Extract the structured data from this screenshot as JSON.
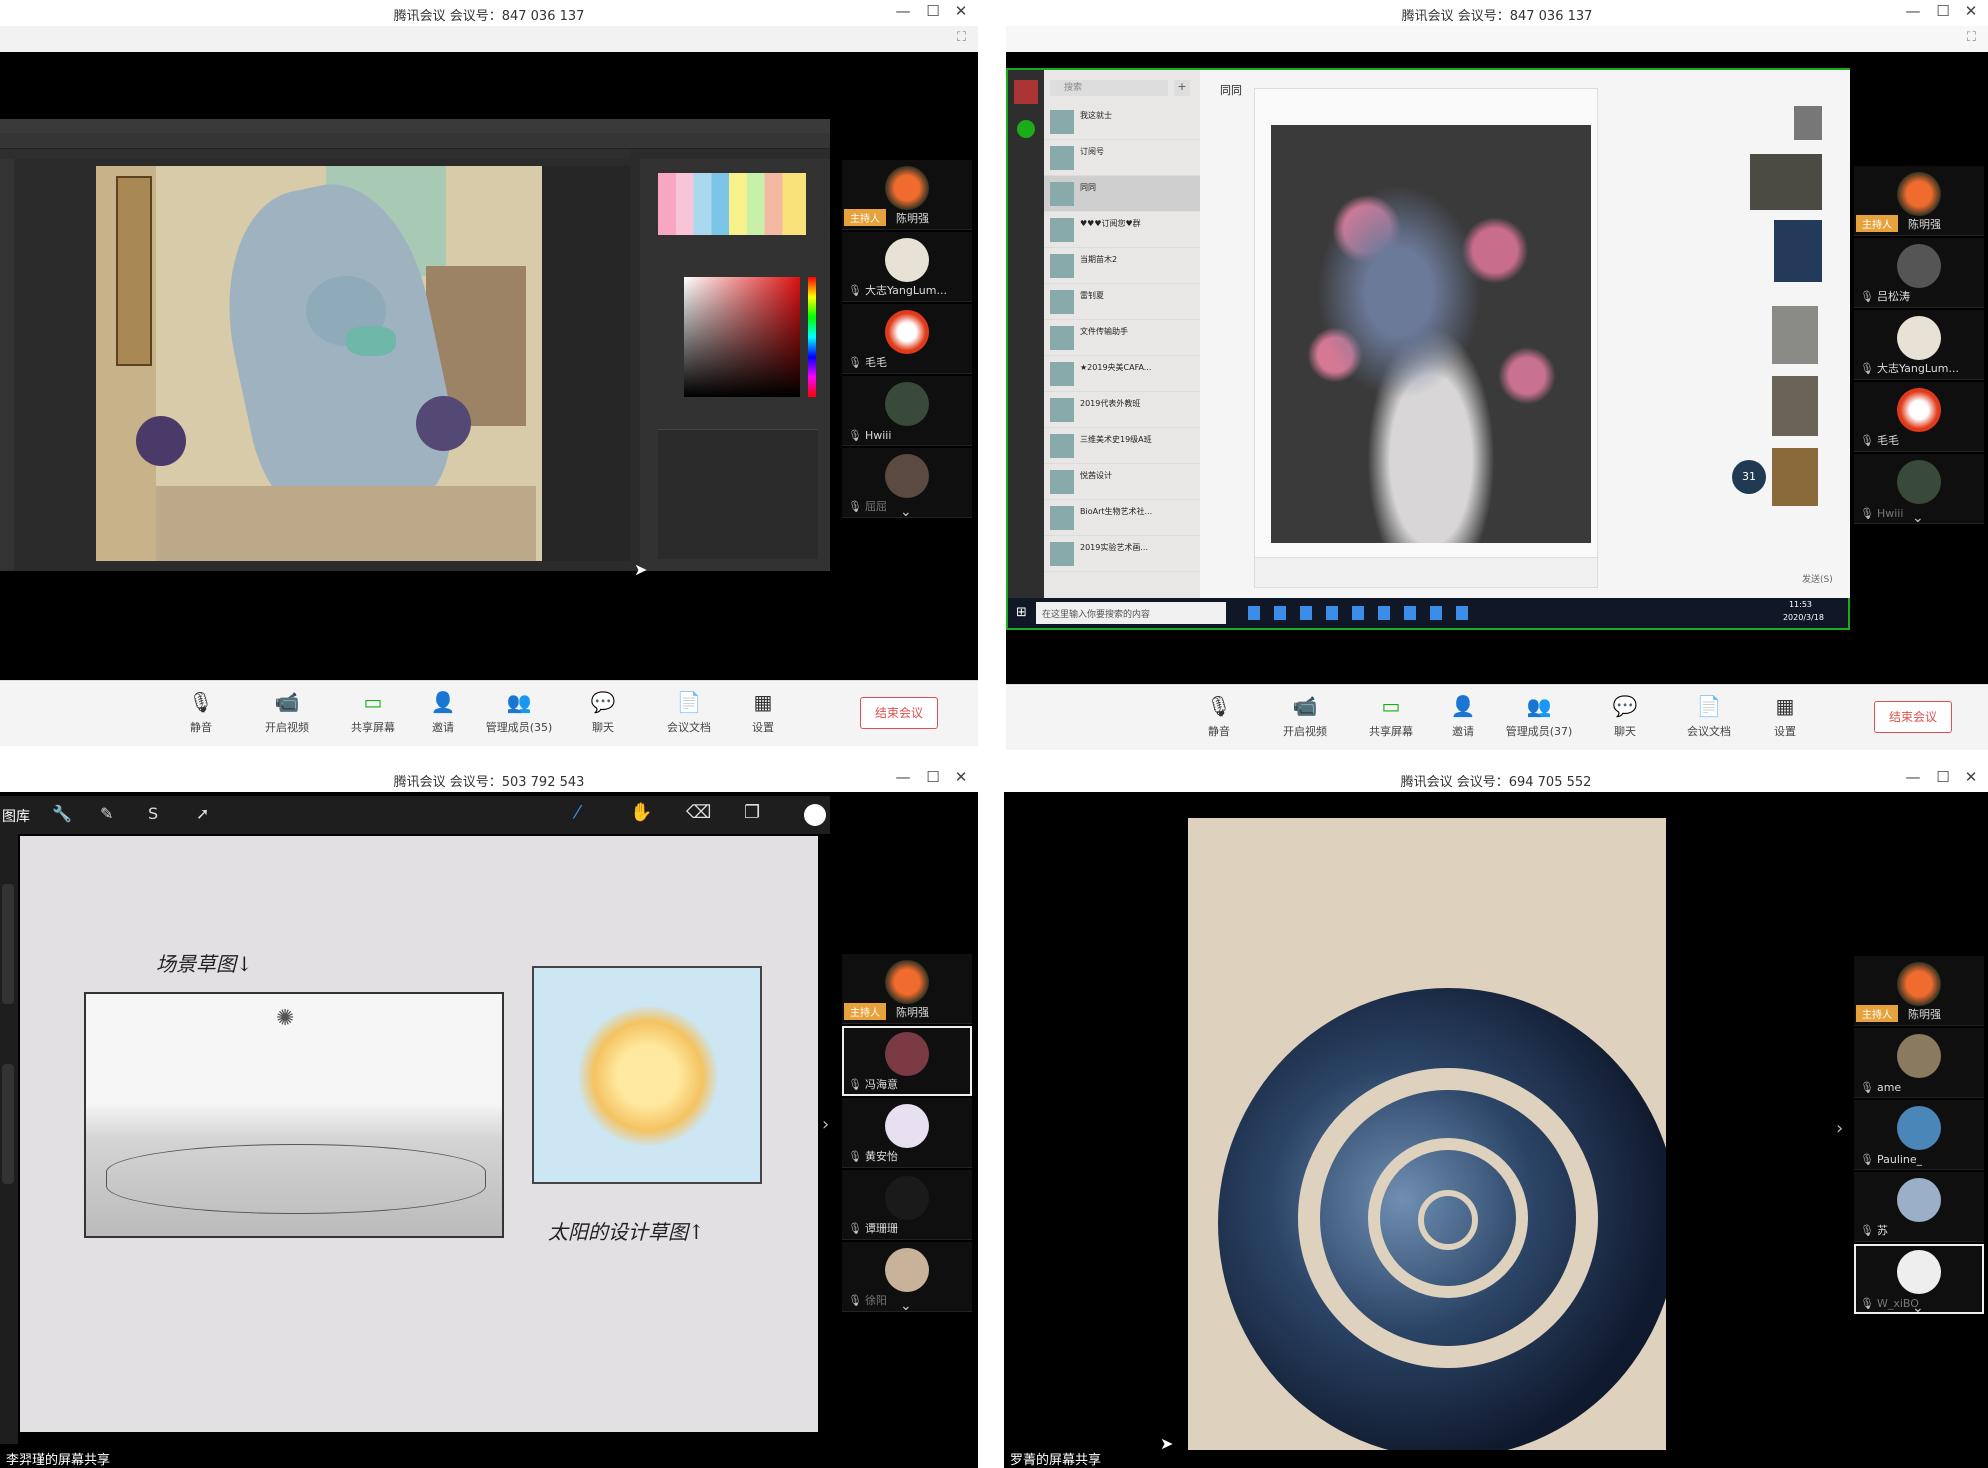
{
  "meetings": [
    {
      "title": "腾讯会议 会议号：847 036 137"
    },
    {
      "title": "腾讯会议 会议号：847 036 137"
    },
    {
      "title": "腾讯会议 会议号：503 792 543"
    },
    {
      "title": "腾讯会议 会议号：694 705 552"
    }
  ],
  "window_controls": {
    "minimize": "—",
    "maximize": "☐",
    "close": "✕",
    "fullscreen": "⛶"
  },
  "toolbar": {
    "mute": "静音",
    "video": "开启视频",
    "share": "共享屏幕",
    "invite": "邀请",
    "members_1": "管理成员(35)",
    "members_2": "管理成员(37)",
    "chat": "聊天",
    "docs": "会议文档",
    "settings": "设置",
    "end": "结束会议"
  },
  "host_badge": "主持人",
  "participants_1": [
    "陈明强",
    "大志YangLum...",
    "毛毛",
    "Hwiii",
    "屈屈"
  ],
  "participants_2": [
    "陈明强",
    "吕松涛",
    "大志YangLum...",
    "毛毛",
    "Hwiii"
  ],
  "participants_3": [
    "陈明强",
    "冯海意",
    "黄安怡",
    "谭珊珊",
    "徐阳"
  ],
  "participants_4": [
    "陈明强",
    "ame",
    "Pauline_",
    "苏",
    "W_xiBO"
  ],
  "share_labels": {
    "q3": "李羿瑾的屏幕共享",
    "q4": "罗菁的屏幕共享"
  },
  "procreate": {
    "gallery": "图库"
  },
  "sketch_notes": {
    "left": "场景草图↓",
    "right": "太阳的设计草图↑"
  },
  "wechat": {
    "search_placeholder": "搜索",
    "window_title": "同同",
    "chats": [
      "我这就士",
      "订阅号",
      "同同",
      "♥♥♥订阅您♥群",
      "当期苗木2",
      "雷钊夏",
      "文件传输助手",
      "★2019央美CAFA...",
      "2019代表外教班",
      "三维美术史19级A班",
      "悦茜设计",
      "BioArt生物艺术社...",
      "2019实验艺术画..."
    ],
    "send": "发送(S)",
    "taskbar_search": "在这里输入你要搜索的内容",
    "clock": "11:53",
    "date": "2020/3/18",
    "badge": "31"
  },
  "colors": {
    "host": "#e6a23c",
    "end": "#e05050",
    "bg": "#000000",
    "toolbar": "#f4f4f4"
  }
}
